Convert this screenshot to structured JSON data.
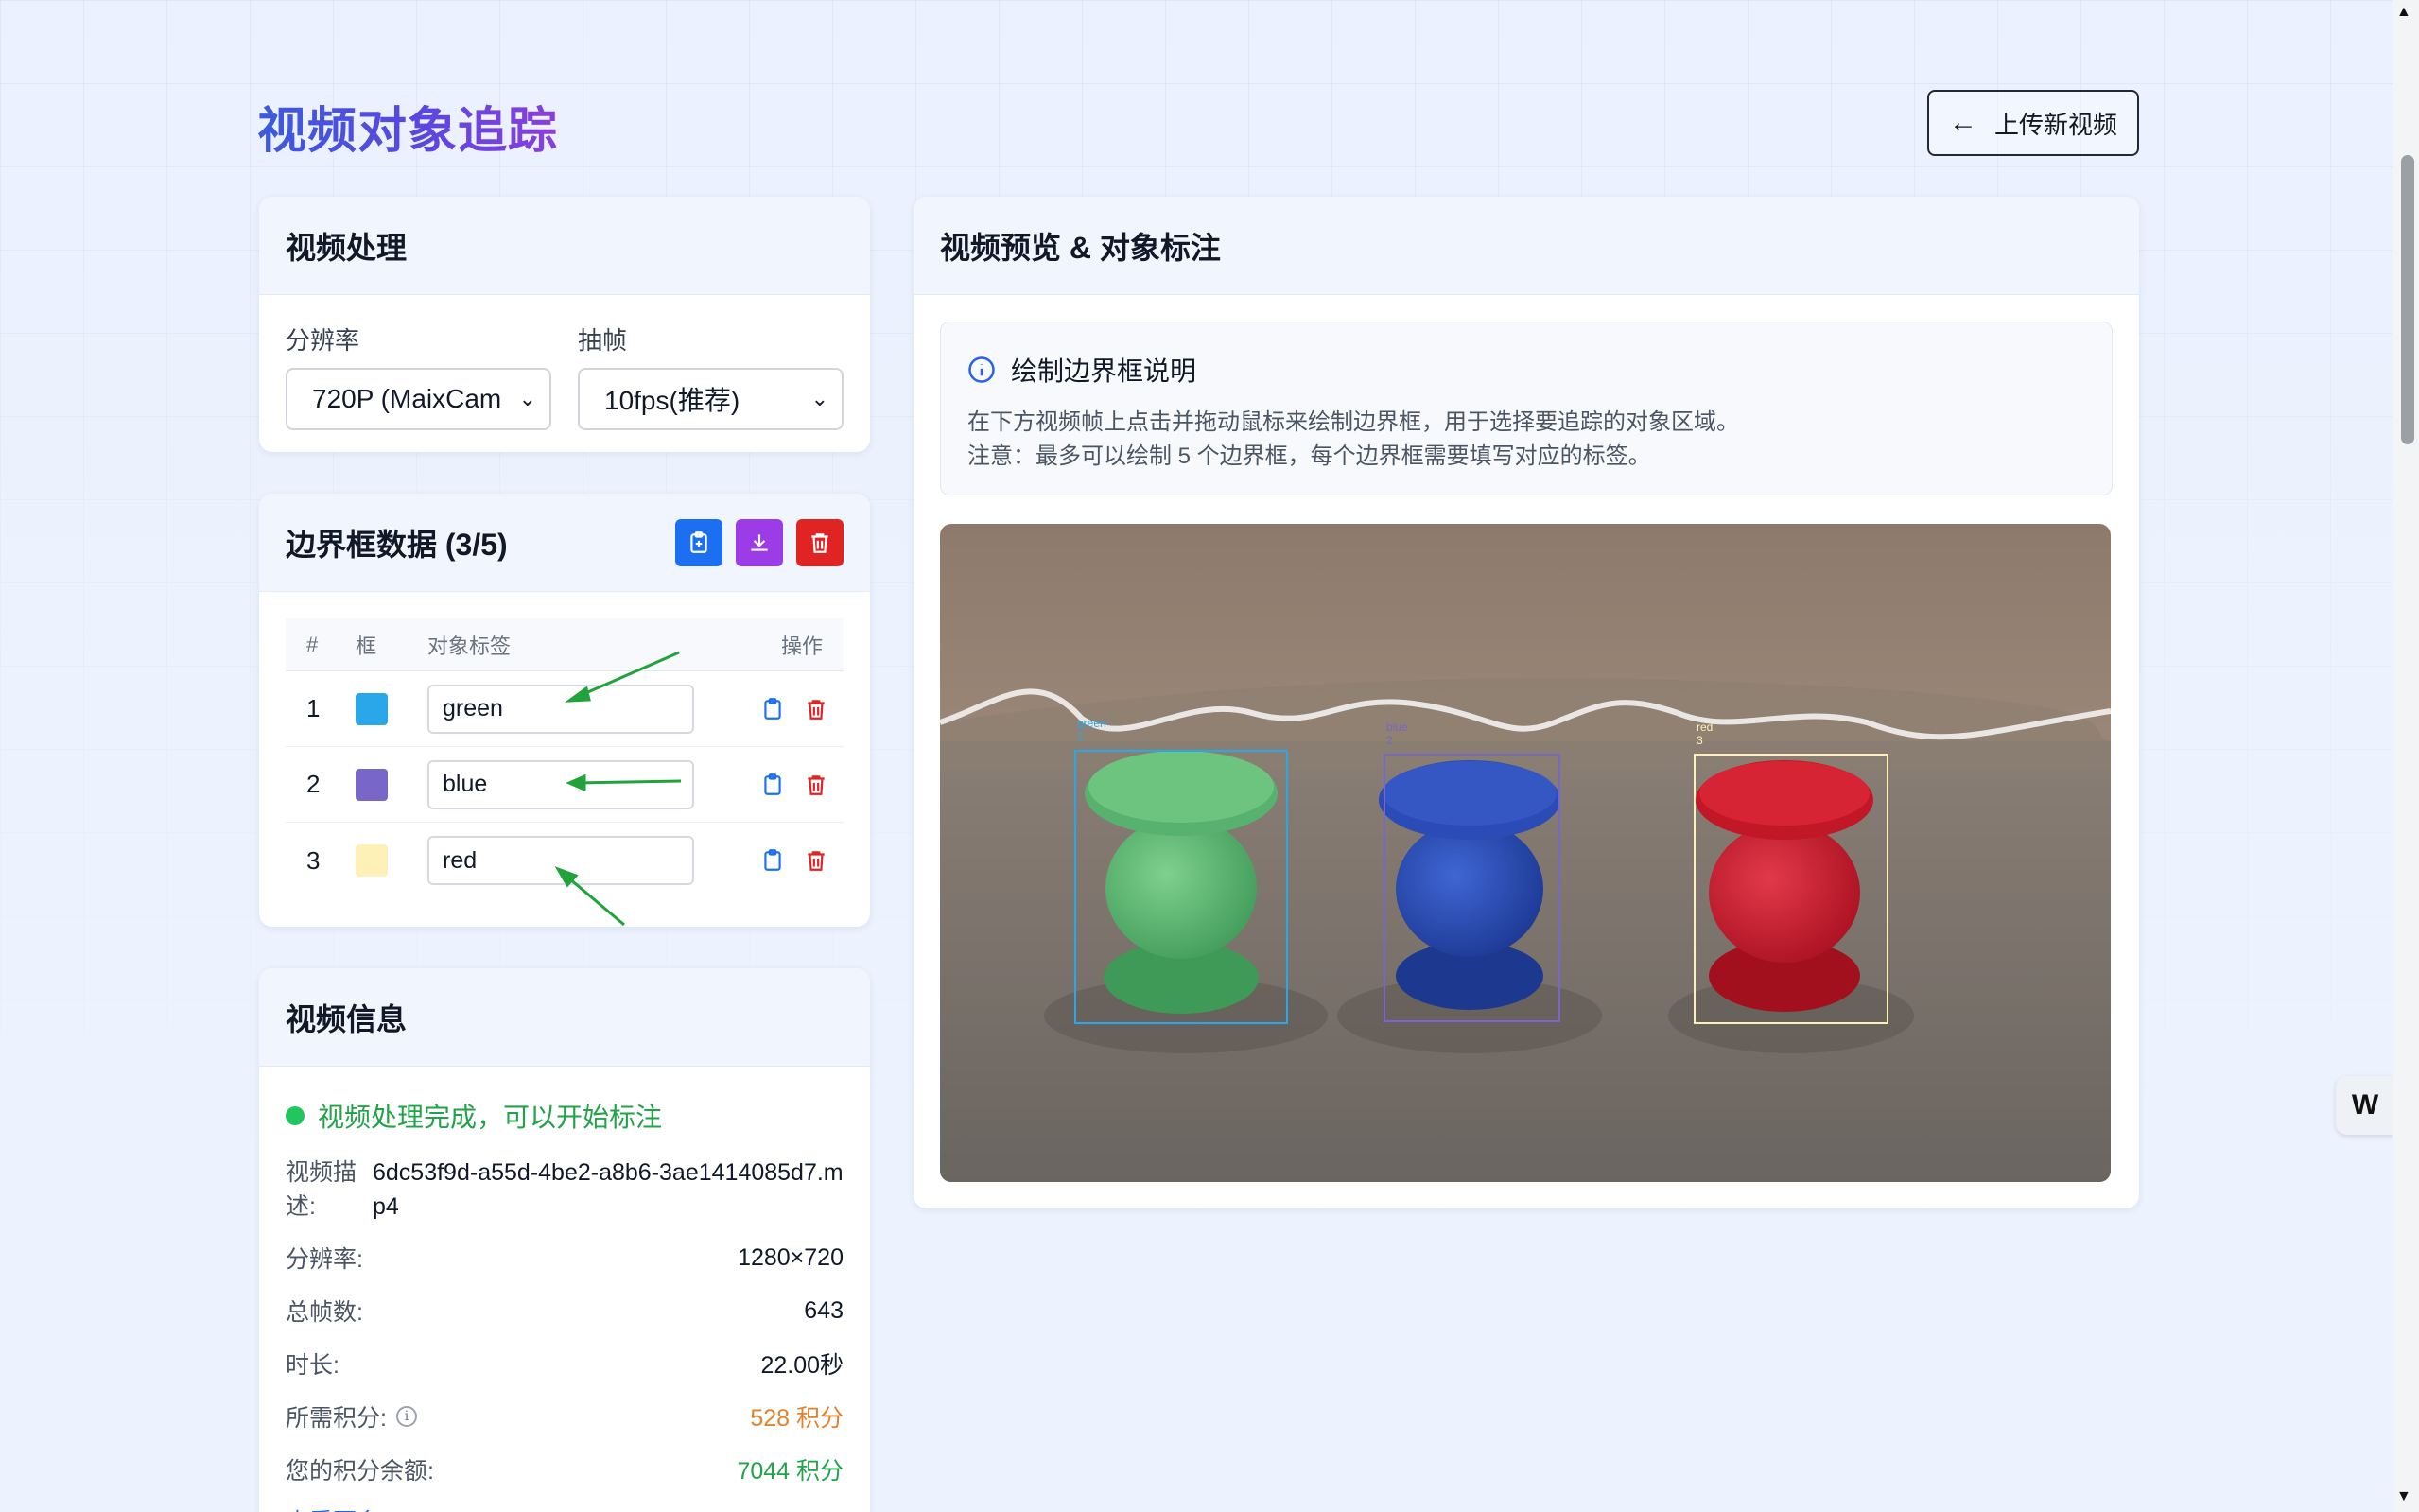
{
  "header": {
    "title": "视频对象追踪",
    "upload_button": "上传新视频",
    "upload_arrow": "←"
  },
  "processing": {
    "title": "视频处理",
    "resolution_label": "分辨率",
    "resolution_value": "720P (MaixCam",
    "frame_label": "抽帧",
    "frame_value": "10fps(推荐)"
  },
  "bbox_data": {
    "title": "边界框数据 (3/5)",
    "columns": {
      "num": "#",
      "box": "框",
      "label": "对象标签",
      "op": "操作"
    },
    "rows": [
      {
        "index": "1",
        "color": "#2aa7e8",
        "label": "green"
      },
      {
        "index": "2",
        "color": "#7866c9",
        "label": "blue"
      },
      {
        "index": "3",
        "color": "#fdf1b8",
        "label": "red"
      }
    ]
  },
  "video_info": {
    "title": "视频信息",
    "status": "视频处理完成，可以开始标注",
    "desc_key": "视频描述:",
    "desc_value": "6dc53f9d-a55d-4be2-a8b6-3ae1414085d7.mp4",
    "resolution_key": "分辨率:",
    "resolution_value": "1280×720",
    "frames_key": "总帧数:",
    "frames_value": "643",
    "duration_key": "时长:",
    "duration_value": "22.00秒",
    "points_key": "所需积分:",
    "points_value": "528 积分",
    "balance_key": "您的积分余额:",
    "balance_value": "7044 积分",
    "more_link": "查看更多"
  },
  "preview": {
    "title": "视频预览 & 对象标注",
    "notice_title": "绘制边界框说明",
    "notice_line1": "在下方视频帧上点击并拖动鼠标来绘制边界框，用于选择要追踪的对象区域。",
    "notice_line2": "注意：最多可以绘制 5 个边界框，每个边界框需要填写对应的标签。",
    "box_labels": [
      "green",
      "blue",
      "red"
    ],
    "box_numbers": [
      "1",
      "2",
      "3"
    ]
  },
  "colors": {
    "accent_blue": "#1d6ff2",
    "accent_purple": "#9c3ce6",
    "danger_red": "#e02424",
    "success_green": "#22a34a",
    "points_orange": "#e0822e"
  },
  "icons": {
    "copy_all": "clipboard-icon",
    "download": "download-icon",
    "delete_all": "trash-icon",
    "row_copy": "clipboard-icon",
    "row_delete": "trash-icon",
    "notice": "info-icon",
    "widget": "w-logo-icon"
  }
}
